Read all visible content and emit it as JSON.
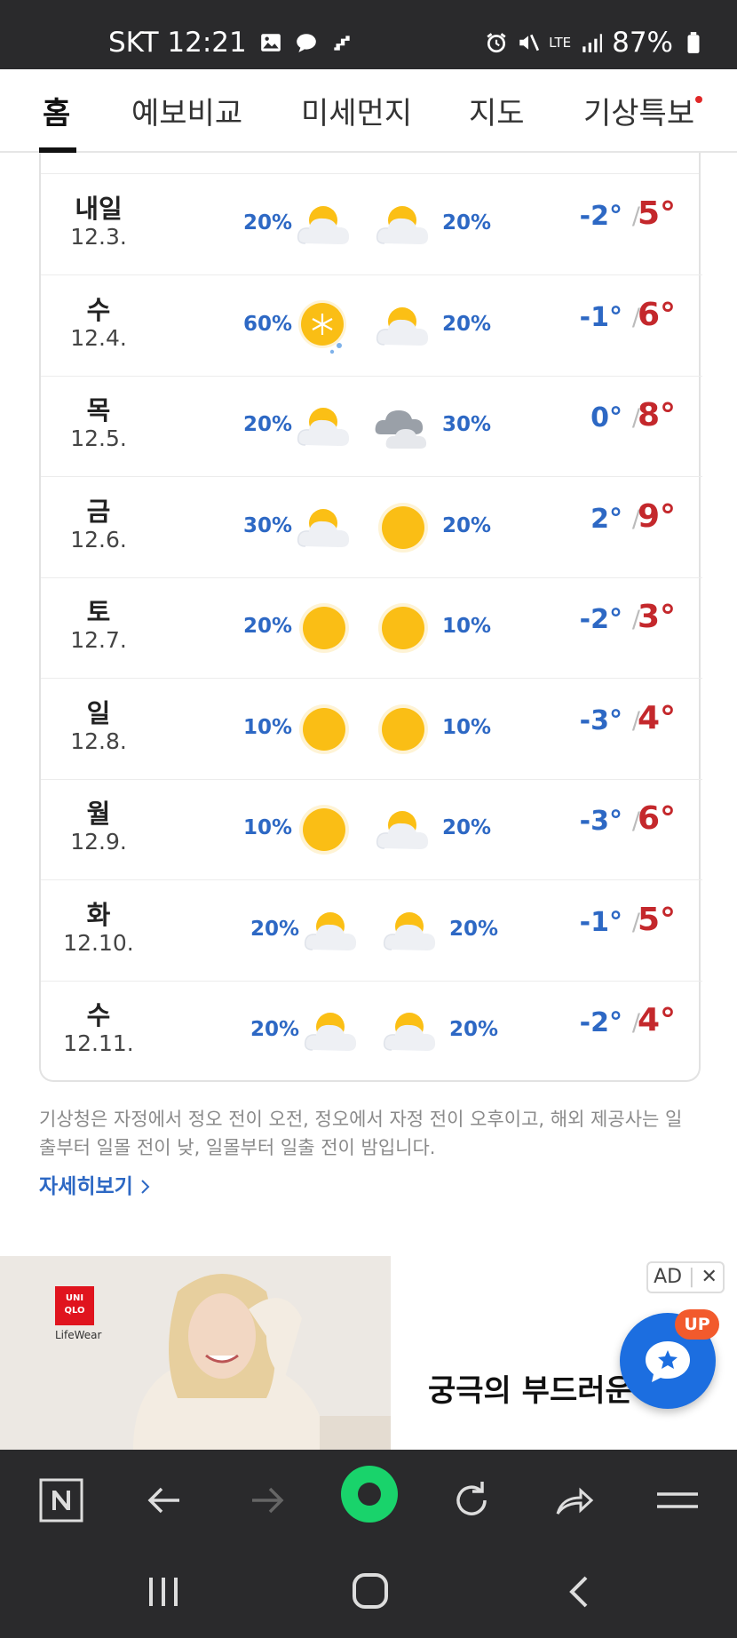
{
  "status_bar": {
    "carrier_time": "SKT 12:21",
    "network": "LTE",
    "battery": "87%"
  },
  "tabs": [
    {
      "label": "홈",
      "active": true
    },
    {
      "label": "예보비교",
      "active": false
    },
    {
      "label": "미세먼지",
      "active": false
    },
    {
      "label": "지도",
      "active": false
    },
    {
      "label": "기상특보",
      "active": false,
      "has_dot": true
    }
  ],
  "forecast": [
    {
      "day": "내일",
      "date": "12.3.",
      "am_pct": "20%",
      "am_icon": "partly-cloudy-icon",
      "pm_pct": "20%",
      "pm_icon": "partly-cloudy-icon",
      "low": "-2°",
      "high": "5°"
    },
    {
      "day": "수",
      "date": "12.4.",
      "am_pct": "60%",
      "am_icon": "snow-icon",
      "pm_pct": "20%",
      "pm_icon": "partly-cloudy-icon",
      "low": "-1°",
      "high": "6°"
    },
    {
      "day": "목",
      "date": "12.5.",
      "am_pct": "20%",
      "am_icon": "partly-cloudy-icon",
      "pm_pct": "30%",
      "pm_icon": "cloudy-icon",
      "low": "0°",
      "high": "8°"
    },
    {
      "day": "금",
      "date": "12.6.",
      "am_pct": "30%",
      "am_icon": "partly-cloudy-icon",
      "pm_pct": "20%",
      "pm_icon": "sunny-icon",
      "low": "2°",
      "high": "9°"
    },
    {
      "day": "토",
      "date": "12.7.",
      "am_pct": "20%",
      "am_icon": "sunny-icon",
      "pm_pct": "10%",
      "pm_icon": "sunny-icon",
      "low": "-2°",
      "high": "3°"
    },
    {
      "day": "일",
      "date": "12.8.",
      "am_pct": "10%",
      "am_icon": "sunny-icon",
      "pm_pct": "10%",
      "pm_icon": "sunny-icon",
      "low": "-3°",
      "high": "4°"
    },
    {
      "day": "월",
      "date": "12.9.",
      "am_pct": "10%",
      "am_icon": "sunny-icon",
      "pm_pct": "20%",
      "pm_icon": "partly-cloudy-icon",
      "low": "-3°",
      "high": "6°"
    },
    {
      "day": "화",
      "date": "12.10.",
      "am_pct": "20%",
      "am_icon": "partly-cloudy-icon",
      "pm_pct": "20%",
      "pm_icon": "partly-cloudy-icon",
      "low": "-1°",
      "high": "5°"
    },
    {
      "day": "수",
      "date": "12.11.",
      "am_pct": "20%",
      "am_icon": "partly-cloudy-icon",
      "pm_pct": "20%",
      "pm_icon": "partly-cloudy-icon",
      "low": "-2°",
      "high": "4°"
    }
  ],
  "temp_separator": "/",
  "note": "기상청은 자정에서 정오 전이 오전, 정오에서 자정 전이 오후이고, 해외 제공사는 일출부터 일몰 전이 낮, 일몰부터 일출 전이 밤입니다.",
  "more_link": "자세히보기",
  "ad": {
    "brand_logo": "UNI QLO",
    "brand_tagline": "LifeWear",
    "badge": "AD",
    "text": "궁극의 부드러운",
    "up_badge": "UP"
  },
  "colors": {
    "low_temp": "#2d68c4",
    "high_temp": "#c4282c",
    "precip": "#2d68c4",
    "bar_bg": "#2a2a2c",
    "fab": "#1c6ee0",
    "up_badge": "#f25a2c"
  }
}
